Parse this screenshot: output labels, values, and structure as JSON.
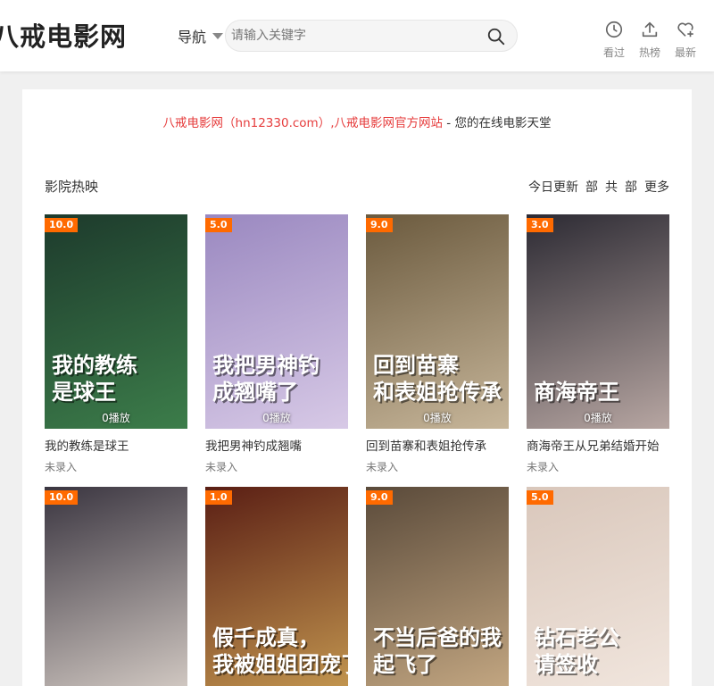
{
  "site": {
    "logo": "八戒电影网",
    "nav_label": "导航",
    "search_placeholder": "请输入关键字"
  },
  "header_actions": [
    {
      "label": "看过",
      "icon": "clock-icon"
    },
    {
      "label": "热榜",
      "icon": "upload-icon"
    },
    {
      "label": "最新",
      "icon": "heart-plus-icon"
    }
  ],
  "notice": {
    "link_text": "八戒电影网（hn12330.com）,八戒电影网官方网站",
    "rest_text": " - 您的在线电影天堂"
  },
  "section": {
    "title": "影院热映",
    "links": [
      "今日更新",
      "部",
      "共",
      "部",
      "更多"
    ]
  },
  "cards": [
    {
      "name": "我的教练是球王",
      "rating": "10.0",
      "plays": "0播放",
      "status": "未录入",
      "art": "我的教练\n是球王",
      "bg": [
        "#1d3a2c",
        "#3c7d4a"
      ]
    },
    {
      "name": "我把男神钓成翘嘴",
      "rating": "5.0",
      "plays": "0播放",
      "status": "未录入",
      "art": "我把男神钓\n成翘嘴了",
      "bg": [
        "#9a88c0",
        "#d7c9e6"
      ]
    },
    {
      "name": "回到苗寨和表姐抢传承",
      "rating": "9.0",
      "plays": "0播放",
      "status": "未录入",
      "art": "回到苗寨\n和表姐抢传承",
      "bg": [
        "#6b5a3e",
        "#c7b69a"
      ]
    },
    {
      "name": "商海帝王从兄弟结婚开始",
      "rating": "3.0",
      "plays": "0播放",
      "status": "未录入",
      "art": "商海帝王",
      "bg": [
        "#2c2a33",
        "#b7a6a2"
      ]
    },
    {
      "name": "",
      "rating": "10.0",
      "plays": "",
      "status": "",
      "art": "",
      "bg": [
        "#3a3540",
        "#d8cfc8"
      ]
    },
    {
      "name": "",
      "rating": "1.0",
      "plays": "",
      "status": "",
      "art": "假千成真，\n我被姐姐团宠了",
      "bg": [
        "#5a1e14",
        "#c79b52"
      ]
    },
    {
      "name": "",
      "rating": "9.0",
      "plays": "",
      "status": "",
      "art": "不当后爸的我\n起飞了",
      "bg": [
        "#5a4a3a",
        "#c8ab85"
      ]
    },
    {
      "name": "",
      "rating": "5.0",
      "plays": "",
      "status": "",
      "art": "钻石老公\n请签收",
      "bg": [
        "#d9c7bb",
        "#f2e7df"
      ]
    }
  ]
}
